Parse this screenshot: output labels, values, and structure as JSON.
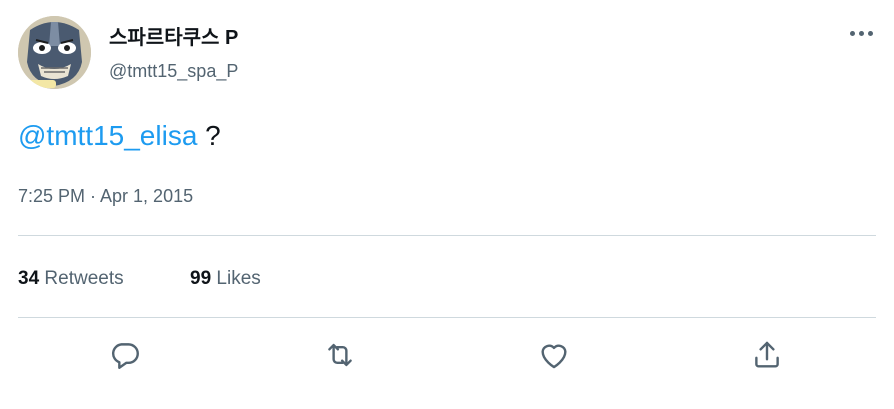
{
  "author": {
    "display_name": "스파르타쿠스 P",
    "handle": "@tmtt15_spa_P",
    "avatar_icon": "masked-wrestler-avatar"
  },
  "tweet": {
    "mention": "@tmtt15_elisa",
    "text_suffix": " ?",
    "timestamp": "7:25 PM · Apr 1, 2015"
  },
  "stats": {
    "retweets": {
      "count": "34",
      "label": "Retweets"
    },
    "likes": {
      "count": "99",
      "label": "Likes"
    }
  },
  "actions": [
    {
      "icon": "reply-icon"
    },
    {
      "icon": "retweet-icon"
    },
    {
      "icon": "like-icon"
    },
    {
      "icon": "share-icon"
    }
  ],
  "colors": {
    "accent": "#1d9bf0",
    "text_primary": "#0f1419",
    "text_secondary": "#536471",
    "divider": "#cfd9de"
  }
}
